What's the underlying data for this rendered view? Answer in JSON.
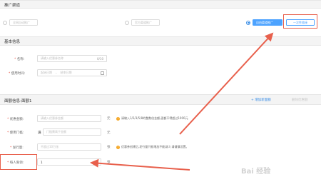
{
  "channel": {
    "title": "推广渠道",
    "options": [
      {
        "label": "全网自动推广",
        "selected": false
      },
      {
        "label": "官方渠道推广",
        "selected": false
      },
      {
        "label": "自由渠道推广",
        "selected": true
      }
    ],
    "generate_button": "一次性链接"
  },
  "basic": {
    "title": "基本信息",
    "name_label": "名称:",
    "name_placeholder": "请输入优惠券名称",
    "name_counter": "0/10",
    "time_label": "使用时间:",
    "start_placeholder": "起始日期",
    "time_separator": "-",
    "end_placeholder": "结束日期"
  },
  "face": {
    "title": "面额信息-面额1",
    "add_link": "+ 增加新面额",
    "delete_link": "删除优惠额",
    "amount_label": "优惠金额:",
    "amount_placeholder": "请输入优惠券金额",
    "amount_unit": "元",
    "amount_hint": "请输入1/2/3/5/8的整数倍金额,面额不得超过1000元",
    "threshold_label": "使用门槛:",
    "threshold_prefix": "满",
    "threshold_placeholder": "门槛需高于金额",
    "threshold_unit": "元",
    "issue_label": "发行量:",
    "issue_placeholder": "不超过10万张",
    "issue_unit": "张",
    "issue_hint": "优惠券创建后,发行量只能增加不能减少,请谨慎设置。",
    "limit_label": "每人限领:",
    "limit_value": "1",
    "limit_unit": "张"
  },
  "watermark": "Bai 经验"
}
